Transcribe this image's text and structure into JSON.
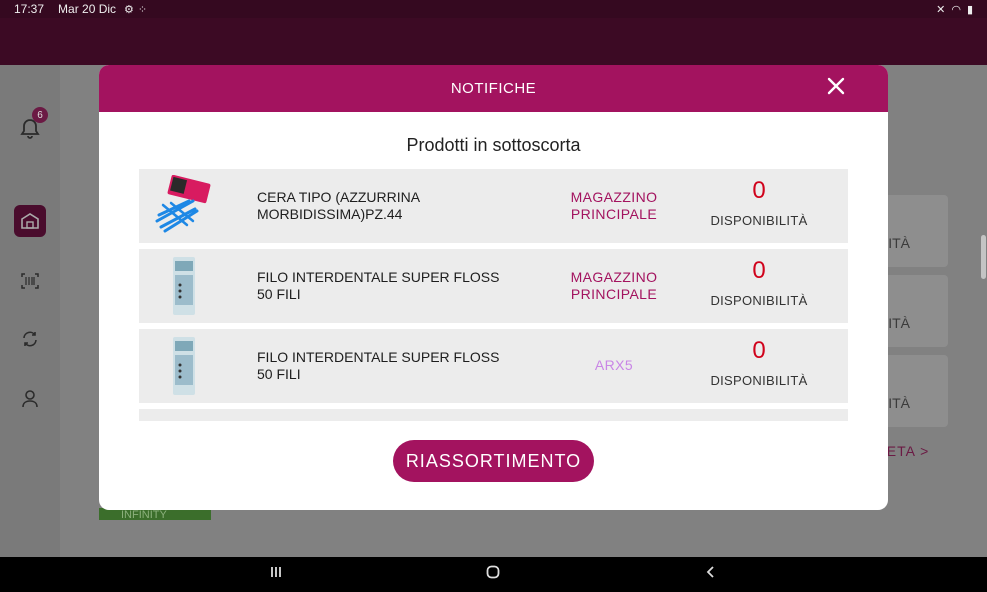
{
  "status_bar": {
    "time": "17:37",
    "date": "Mar 20 Dic",
    "icons": [
      "settings-icon",
      "grid-icon"
    ],
    "right_icons": [
      "mute-icon",
      "wifi-icon",
      "battery-icon"
    ]
  },
  "sidebar": {
    "notification_count": "6",
    "items": [
      {
        "icon": "bell-icon"
      },
      {
        "icon": "warehouse-icon",
        "active": true
      },
      {
        "icon": "barcode-scan-icon"
      },
      {
        "icon": "sync-icon"
      },
      {
        "icon": "user-icon"
      }
    ]
  },
  "background": {
    "card_suffix_1": "ITÀ",
    "card_suffix_2": "ITÀ",
    "card_suffix_3": "ITÀ",
    "link_fragment": "LETA  >",
    "green_badge": "INFINITY"
  },
  "modal": {
    "title": "NOTIFICHE",
    "section_title": "Prodotti in sottoscorta",
    "close_icon": "close-icon",
    "products": [
      {
        "name": "CERA TIPO  (AZZURRINA MORBIDISSIMA)PZ.44",
        "location": "MAGAZZINO PRINCIPALE",
        "quantity": "0",
        "quantity_label": "DISPONIBILITÀ"
      },
      {
        "name": "FILO INTERDENTALE SUPER FLOSS 50 FILI",
        "location": "MAGAZZINO PRINCIPALE",
        "quantity": "0",
        "quantity_label": "DISPONIBILITÀ"
      },
      {
        "name": "FILO INTERDENTALE SUPER FLOSS 50 FILI",
        "location": "ARX5",
        "quantity": "0",
        "quantity_label": "DISPONIBILITÀ"
      }
    ],
    "restock_button": "RIASSORTIMENTO"
  },
  "colors": {
    "brand": "#a3135f",
    "quantity": "#d0021b",
    "location_light": "#c986e6"
  }
}
